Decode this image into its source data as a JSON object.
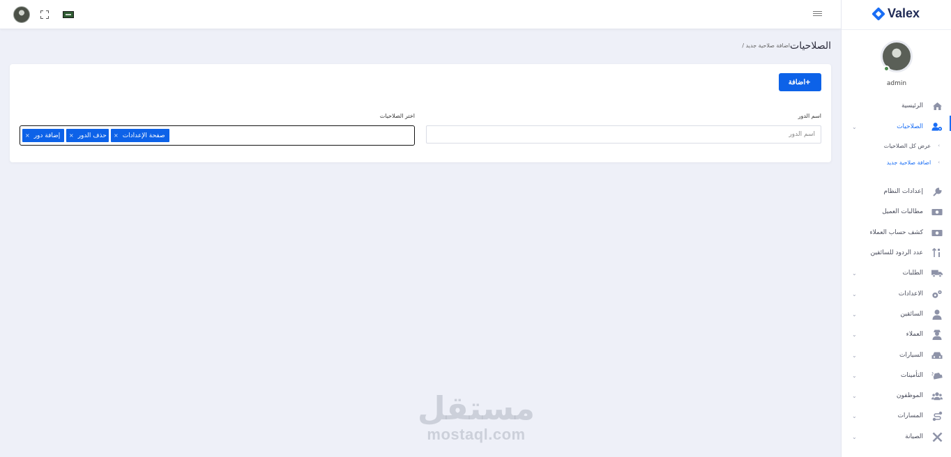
{
  "header": {
    "avatar": "user-avatar",
    "expand_icon": "fullscreen-icon",
    "flag_icon": "flag-icon",
    "menu_icon": "hamburger-icon"
  },
  "sidebar": {
    "logo_text": "Valex",
    "user_name": "admin",
    "items": [
      {
        "label": "الرئيسية",
        "icon": "home-icon",
        "has_chevron": false
      },
      {
        "label": "الصلاحيات",
        "icon": "user-gear-icon",
        "has_chevron": true,
        "active": true
      },
      {
        "label": "إعدادات النظام",
        "icon": "wrench-icon",
        "has_chevron": false
      },
      {
        "label": "مطالبات العميل",
        "icon": "money-icon",
        "has_chevron": false
      },
      {
        "label": "كشف حساب العملاء",
        "icon": "money-icon",
        "has_chevron": false
      },
      {
        "label": "عدد الردود للسائقين",
        "icon": "sort-icon",
        "has_chevron": false
      },
      {
        "label": "الطلبات",
        "icon": "truck-icon",
        "has_chevron": true
      },
      {
        "label": "الاعدادات",
        "icon": "gears-icon",
        "has_chevron": true
      },
      {
        "label": "السائقين",
        "icon": "user-icon",
        "has_chevron": true
      },
      {
        "label": "العملاء",
        "icon": "user-secret-icon",
        "has_chevron": true
      },
      {
        "label": "السيارات",
        "icon": "car-icon",
        "has_chevron": true
      },
      {
        "label": "التأمينات",
        "icon": "car-crash-icon",
        "has_chevron": true
      },
      {
        "label": "الموظفون",
        "icon": "users-icon",
        "has_chevron": true
      },
      {
        "label": "المسارات",
        "icon": "route-icon",
        "has_chevron": true
      },
      {
        "label": "الصيانة",
        "icon": "tools-icon",
        "has_chevron": true
      }
    ],
    "sub_items": [
      {
        "label": "عرض كل الصلاحيات"
      },
      {
        "label": "اضافة صلاحية جديد",
        "current": true
      }
    ]
  },
  "page": {
    "title": "الصلاحيات",
    "breadcrumb": "/ اضافة صلاحية جديد"
  },
  "form": {
    "add_button": "اضافة",
    "role_name_label": "اسم الدور",
    "role_name_placeholder": "اسم الدور",
    "permissions_label": "اختر الصلاحيات",
    "selected_permissions": [
      "صفحة الإعدادات",
      "حذف الدور",
      "إضافة دور"
    ]
  },
  "watermark": {
    "arabic": "مستقل",
    "latin": "mostaql.com"
  }
}
